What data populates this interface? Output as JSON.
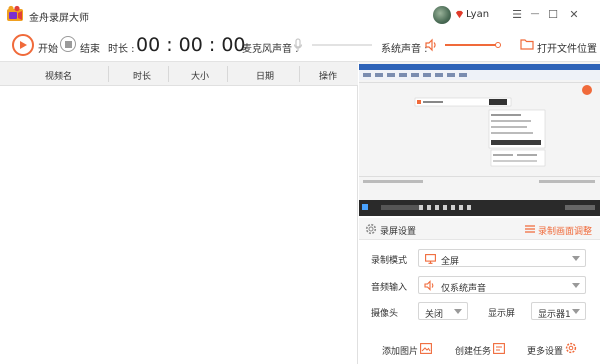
{
  "app": {
    "title": "金舟录屏大师"
  },
  "user": {
    "name": "Lyan"
  },
  "window_controls": {
    "menu": "☰",
    "minimize": "—",
    "maximize": "☐",
    "close": "✕"
  },
  "toolbar": {
    "start_label": "开始",
    "stop_label": "结束",
    "duration_label": "时长 :",
    "timer": "00 : 00 : 00",
    "mic_label": "麦克风声音 :",
    "system_sound_label": "系统声音 :",
    "open_folder_label": "打开文件位置",
    "mic_level": 0.0,
    "system_level": 1.0
  },
  "table": {
    "columns": [
      "视频名",
      "时长",
      "大小",
      "日期",
      "操作"
    ],
    "rows": []
  },
  "settings": {
    "title": "录屏设置",
    "adjust_label": "录制画面调整",
    "record_mode_label": "录制模式",
    "record_mode_value": "全屏",
    "audio_input_label": "音频输入",
    "audio_input_value": "仅系统声音",
    "camera_label": "摄像头",
    "camera_value": "关闭",
    "display_label": "显示屏",
    "display_value": "显示器1"
  },
  "actions": {
    "add_image": "添加图片",
    "create_task": "创建任务",
    "more_settings": "更多设置"
  },
  "colors": {
    "accent": "#f06a3a",
    "header_bg": "#f2f2f2"
  }
}
